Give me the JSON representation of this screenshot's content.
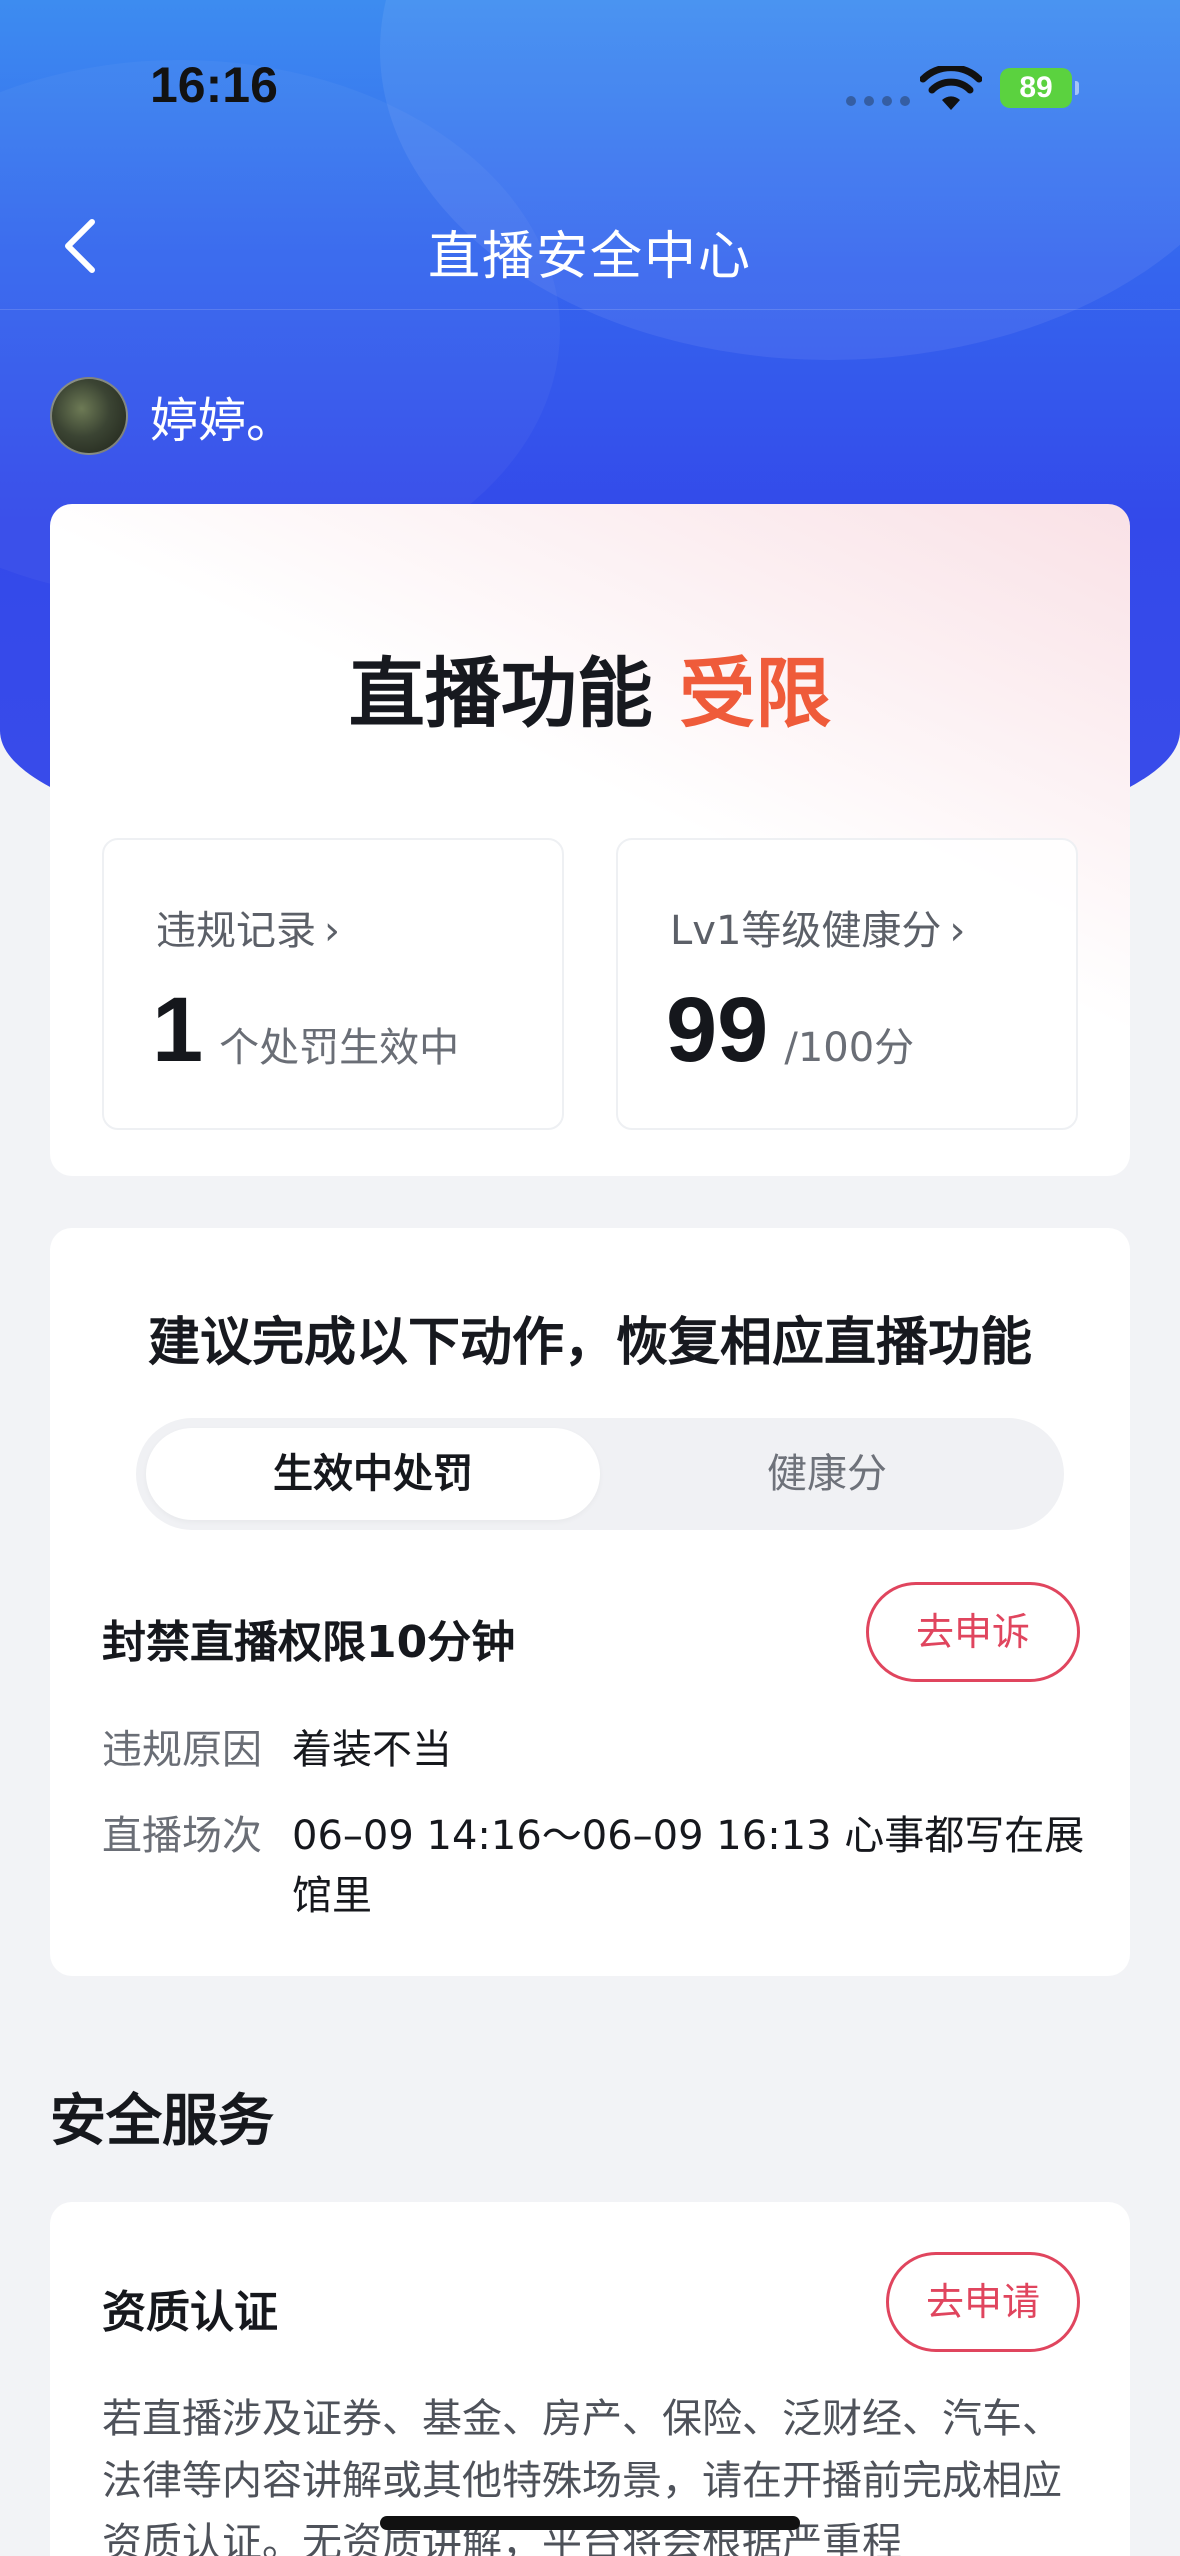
{
  "status_bar": {
    "time": "16:16",
    "battery": "89"
  },
  "nav": {
    "title": "直播安全中心"
  },
  "user": {
    "name": "婷婷。"
  },
  "status_card": {
    "heading_prefix": "直播功能",
    "heading_status": "受限",
    "violations": {
      "label": "违规记录",
      "value": "1",
      "unit": "个处罚生效中"
    },
    "health": {
      "label": "Lv1等级健康分",
      "value": "99",
      "unit": "/100分"
    },
    "chevron": "›"
  },
  "actions_card": {
    "title": "建议完成以下动作，恢复相应直播功能",
    "tabs": [
      "生效中处罚",
      "健康分"
    ],
    "active_tab": 0,
    "penalty": {
      "title": "封禁直播权限10分钟",
      "appeal_label": "去申诉",
      "reason_key": "违规原因",
      "reason_value": "着装不当",
      "session_key": "直播场次",
      "session_value": "06–09 14:16～06–09 16:13 心事都写在展馆里"
    }
  },
  "services": {
    "section_title": "安全服务",
    "qualification": {
      "title": "资质认证",
      "apply_label": "去申请",
      "description": "若直播涉及证券、基金、房产、保险、泛财经、汽车、法律等内容讲解或其他特殊场景，请在开播前完成相应资质认证。无资质讲解，平台将会根据严重程"
    }
  },
  "colors": {
    "accent_red": "#e0455e",
    "status_orange": "#ef5b3a",
    "hero_blue": "#3349ea"
  }
}
